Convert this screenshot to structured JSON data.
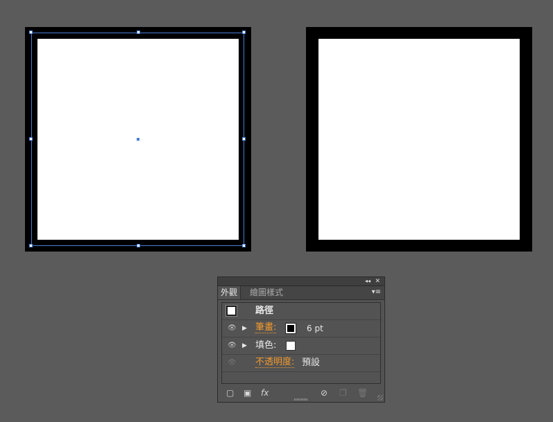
{
  "panel": {
    "collapse_label": "◂◂",
    "close_label": "✕",
    "tabs": [
      {
        "label": "外觀"
      },
      {
        "label": "繪圖樣式"
      }
    ],
    "menu_label": "▾≡",
    "object_type": "路徑",
    "rows": {
      "stroke": {
        "label": "筆畫:",
        "value": "6 pt"
      },
      "fill": {
        "label": "填色:"
      },
      "opacity": {
        "label": "不透明度:",
        "value": "預設"
      }
    }
  },
  "icons": {
    "eye": "eye-icon",
    "expand": "disclosure-triangle-icon",
    "add_stroke": "add-new-stroke-icon",
    "add_fill": "add-new-fill-icon",
    "fx": "fx-icon",
    "clear": "clear-appearance-icon",
    "duplicate": "duplicate-item-icon",
    "delete": "trash-icon"
  },
  "bottom": {
    "fx_label": "fx"
  },
  "colors": {
    "canvas_bg": "#5b5b5b",
    "selection": "#4a7fd8",
    "link_orange": "#f29a2e",
    "stroke_color": "#000000",
    "fill_color": "#ffffff"
  }
}
